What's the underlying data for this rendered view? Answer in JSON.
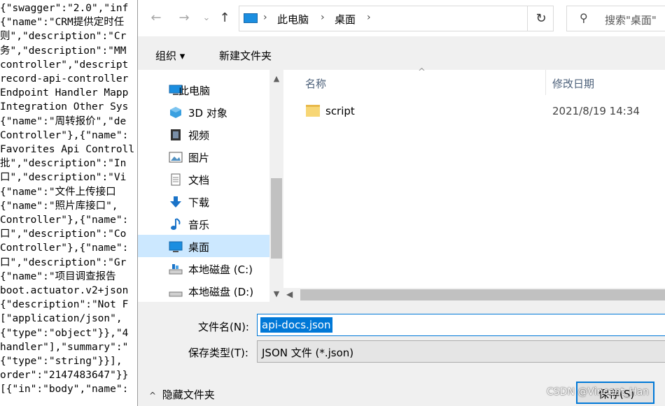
{
  "background_text": [
    "{\"swagger\":\"2.0\",\"inf",
    "{\"name\":\"CRM提供定时任",
    "则\",\"description\":\"Cr",
    "务\",\"description\":\"MM",
    "controller\",\"descript",
    "record-api-controller",
    "Endpoint Handler Mapp",
    "Integration Other Sys",
    "{\"name\":\"周转报价\",\"de",
    "Controller\"},{\"name\":",
    "Favorites Api Controll",
    "批\",\"description\":\"In",
    "口\",\"description\":\"Vi",
    "{\"name\":\"文件上传接口",
    "{\"name\":\"照片库接口\",",
    "Controller\"},{\"name\":",
    "口\",\"description\":\"Co",
    "Controller\"},{\"name\":",
    "口\",\"description\":\"Gr",
    "{\"name\":\"项目调查报告",
    "boot.actuator.v2+json",
    "{\"description\":\"Not F",
    "[\"application/json\",",
    "{\"type\":\"object\"}},\"4",
    "handler\"],\"summary\":\"",
    "{\"type\":\"string\"}}],",
    "order\":\"2147483647\"}}",
    "[{\"in\":\"body\",\"name\":"
  ],
  "nav": {
    "back_icon": "←",
    "forward_icon": "→",
    "recent_icon": "⌄",
    "up_icon": "↑",
    "separator": "›",
    "crumbs": [
      "此电脑",
      "桌面"
    ],
    "refresh_icon": "↻",
    "search_icon": "⚲",
    "search_placeholder": "搜索\"桌面\""
  },
  "toolbar": {
    "organize_label": "组织 ▾",
    "new_folder_label": "新建文件夹"
  },
  "sidebar": {
    "items": [
      {
        "label": "此电脑",
        "icon": "computer-icon"
      },
      {
        "label": "3D 对象",
        "icon": "3d-objects-icon"
      },
      {
        "label": "视频",
        "icon": "video-icon"
      },
      {
        "label": "图片",
        "icon": "pictures-icon"
      },
      {
        "label": "文档",
        "icon": "documents-icon"
      },
      {
        "label": "下载",
        "icon": "download-icon"
      },
      {
        "label": "音乐",
        "icon": "music-icon"
      },
      {
        "label": "桌面",
        "icon": "desktop-icon",
        "selected": true
      },
      {
        "label": "本地磁盘 (C:)",
        "icon": "drive-icon"
      },
      {
        "label": "本地磁盘 (D:)",
        "icon": "drive-icon"
      }
    ]
  },
  "files": {
    "header_name": "名称",
    "header_date": "修改日期",
    "sort_indicator": "^",
    "rows": [
      {
        "name": "script",
        "date": "2021/8/19 14:34"
      }
    ]
  },
  "form": {
    "filename_label": "文件名(N):",
    "filename_value": "api-docs.json",
    "filetype_label": "保存类型(T):",
    "filetype_value": "JSON 文件 (*.json)",
    "hide_folders_label": "隐藏文件夹",
    "hide_folders_chevron": "^",
    "save_label": "保存(S)"
  },
  "watermark": "CSDN @Vincent_Han",
  "colors": {
    "accent": "#0078d7",
    "selection": "#cce8ff"
  }
}
